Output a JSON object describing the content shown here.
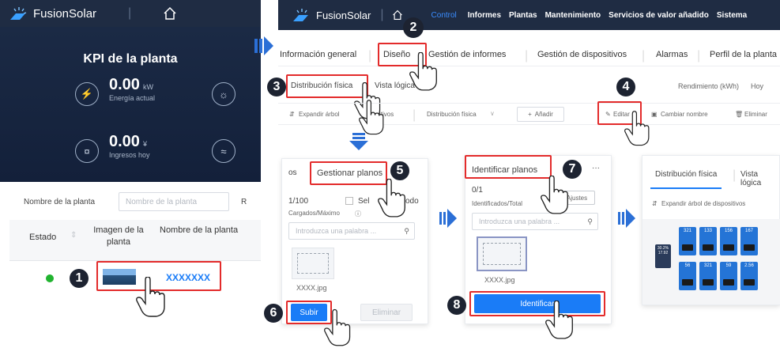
{
  "app": {
    "name": "FusionSolar"
  },
  "left": {
    "kpi_title": "KPI de la planta",
    "energy_value": "0.00",
    "energy_unit": "kW",
    "energy_label": "Energía actual",
    "income_value": "0.00",
    "income_unit": "¥",
    "income_label": "Ingresos hoy",
    "plant_name_label": "Nombre de la planta",
    "plant_name_placeholder": "Nombre de la planta",
    "cut_letter": "R",
    "col_estado": "Estado",
    "col_imagen": "Imagen de la planta",
    "col_nombre": "Nombre de la planta",
    "row_name": "XXXXXXX"
  },
  "nav": {
    "items": [
      "Control",
      "Informes",
      "Plantas",
      "Mantenimiento",
      "Servicios de valor añadido",
      "Sistema"
    ]
  },
  "tabs": {
    "items": [
      "Información general",
      "Diseño",
      "Gestión de informes",
      "Gestión de dispositivos",
      "Alarmas",
      "Perfil de la planta"
    ]
  },
  "subtabs": {
    "physical": "Distribución física",
    "logical": "Vista lógica",
    "rendimiento": "Rendimiento (kWh)",
    "hoy": "Hoy"
  },
  "toolbar": {
    "expand": "Expandir árbol",
    "expand_cut": "itivos",
    "dist": "Distribución física",
    "add": "Añadir",
    "edit": "Editar",
    "rename": "Cambiar nombre",
    "delete": "Eliminar"
  },
  "gestionar": {
    "tab_os": "os",
    "tab_label": "Gestionar planos",
    "count": "1/100",
    "select_all_prefix": "Sel",
    "select_all_suffix": "odo",
    "uploaded": "Cargados/Máximo",
    "search_placeholder": "Introduzca una palabra ...",
    "file": "XXXX.jpg",
    "upload": "Subir",
    "delete": "Eliminar"
  },
  "identificar": {
    "tab_label": "Identificar planos",
    "more": "···",
    "count": "0/1",
    "identified": "Identificados/Total",
    "ajustes": "Ajustes",
    "search_placeholder": "Introduzca una palabra ...",
    "file": "XXXX.jpg",
    "button": "Identificar"
  },
  "result": {
    "tab1": "Distribución física",
    "tab2": "Vista lógica",
    "expand": "Expandir árbol de dispositivos",
    "tile_side_1": "30.2%",
    "tile_side_2": "17.92",
    "tiles_top": [
      "321",
      "133",
      "156",
      "167"
    ],
    "tiles_bottom": [
      "56",
      "321",
      "59",
      "2.56"
    ]
  },
  "steps": [
    "1",
    "2",
    "3",
    "4",
    "5",
    "6",
    "7",
    "8"
  ],
  "colors": {
    "primary": "#1a7cf7",
    "highlight": "#e32b2b",
    "dark_header": "#16233a",
    "badge": "#1d2331"
  }
}
